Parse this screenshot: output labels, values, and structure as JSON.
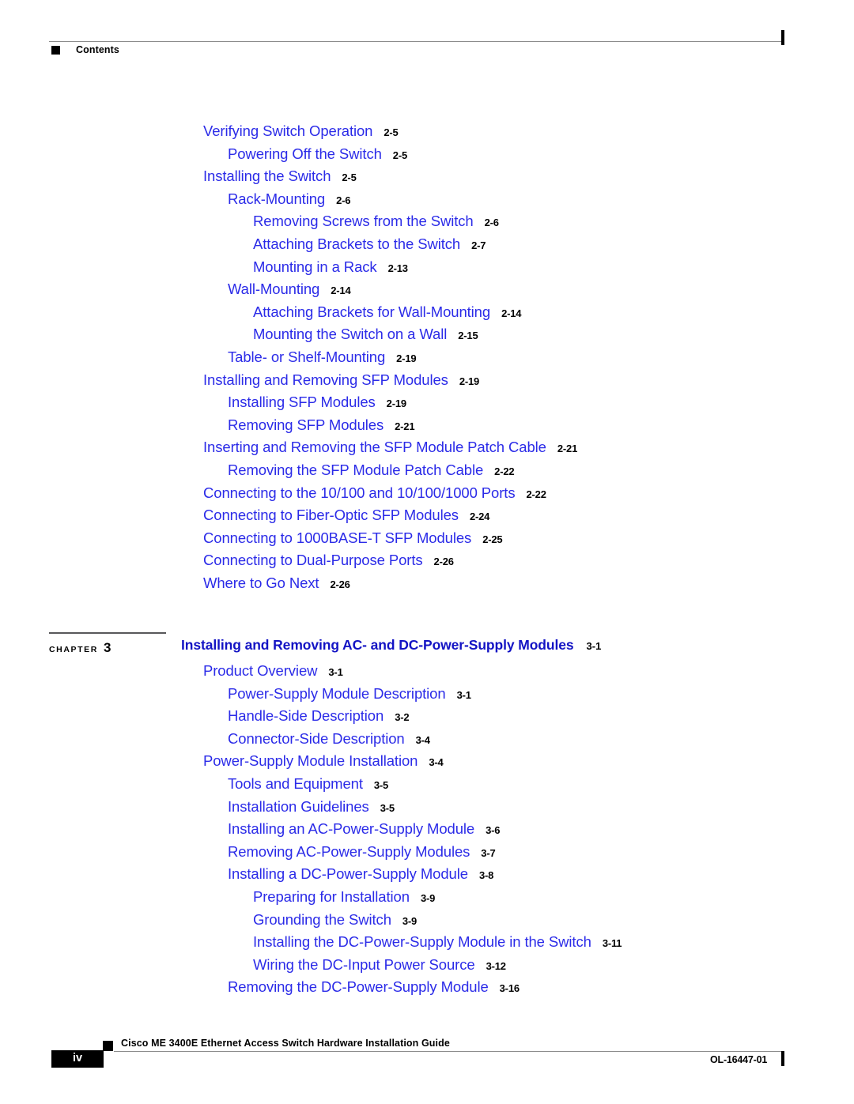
{
  "header": {
    "title": "Contents",
    "square_icon": "black-square-bullet"
  },
  "colors": {
    "entry_link": "#2b2be8",
    "chapter_title": "#1313c4",
    "page_number": "#000000",
    "rule": "#8c8c8c",
    "page_background": "#ffffff"
  },
  "toc": {
    "entries": [
      {
        "label": "Verifying Switch Operation",
        "page": "2-5",
        "level": 1
      },
      {
        "label": "Powering Off the Switch",
        "page": "2-5",
        "level": 2
      },
      {
        "label": "Installing the Switch",
        "page": "2-5",
        "level": 1
      },
      {
        "label": "Rack-Mounting",
        "page": "2-6",
        "level": 2
      },
      {
        "label": "Removing Screws from the Switch",
        "page": "2-6",
        "level": 3
      },
      {
        "label": "Attaching Brackets to the Switch",
        "page": "2-7",
        "level": 3
      },
      {
        "label": "Mounting in a Rack",
        "page": "2-13",
        "level": 3
      },
      {
        "label": "Wall-Mounting",
        "page": "2-14",
        "level": 2
      },
      {
        "label": "Attaching Brackets for Wall-Mounting",
        "page": "2-14",
        "level": 3
      },
      {
        "label": "Mounting the Switch on a Wall",
        "page": "2-15",
        "level": 3
      },
      {
        "label": "Table- or Shelf-Mounting",
        "page": "2-19",
        "level": 2
      },
      {
        "label": "Installing and Removing SFP Modules",
        "page": "2-19",
        "level": 1
      },
      {
        "label": "Installing SFP Modules",
        "page": "2-19",
        "level": 2
      },
      {
        "label": "Removing SFP Modules",
        "page": "2-21",
        "level": 2
      },
      {
        "label": "Inserting and Removing the SFP Module Patch Cable",
        "page": "2-21",
        "level": 1
      },
      {
        "label": "Removing the SFP Module Patch Cable",
        "page": "2-22",
        "level": 2
      },
      {
        "label": "Connecting to the 10/100 and 10/100/1000 Ports",
        "page": "2-22",
        "level": 1
      },
      {
        "label": "Connecting to Fiber-Optic SFP Modules",
        "page": "2-24",
        "level": 1
      },
      {
        "label": "Connecting to 1000BASE-T SFP Modules",
        "page": "2-25",
        "level": 1
      },
      {
        "label": "Connecting to Dual-Purpose Ports",
        "page": "2-26",
        "level": 1
      },
      {
        "label": "Where to Go Next",
        "page": "2-26",
        "level": 1
      }
    ],
    "entries2": [
      {
        "label": "Product Overview",
        "page": "3-1",
        "level": 1
      },
      {
        "label": "Power-Supply Module Description",
        "page": "3-1",
        "level": 2
      },
      {
        "label": "Handle-Side Description",
        "page": "3-2",
        "level": 2
      },
      {
        "label": "Connector-Side Description",
        "page": "3-4",
        "level": 2
      },
      {
        "label": "Power-Supply Module Installation",
        "page": "3-4",
        "level": 1
      },
      {
        "label": "Tools and Equipment",
        "page": "3-5",
        "level": 2
      },
      {
        "label": "Installation Guidelines",
        "page": "3-5",
        "level": 2
      },
      {
        "label": "Installing an AC-Power-Supply Module",
        "page": "3-6",
        "level": 2
      },
      {
        "label": "Removing AC-Power-Supply Modules",
        "page": "3-7",
        "level": 2
      },
      {
        "label": "Installing a DC-Power-Supply Module",
        "page": "3-8",
        "level": 2
      },
      {
        "label": "Preparing for Installation",
        "page": "3-9",
        "level": 3
      },
      {
        "label": "Grounding the Switch",
        "page": "3-9",
        "level": 3
      },
      {
        "label": "Installing the DC-Power-Supply Module in the Switch",
        "page": "3-11",
        "level": 3
      },
      {
        "label": "Wiring the DC-Input Power Source",
        "page": "3-12",
        "level": 3
      },
      {
        "label": "Removing the DC-Power-Supply Module",
        "page": "3-16",
        "level": 2
      }
    ]
  },
  "chapter": {
    "marker_word": "CHAPTER",
    "marker_number": "3",
    "title": "Installing and Removing AC- and DC-Power-Supply Modules",
    "page": "3-1"
  },
  "footer": {
    "page_number": "iv",
    "title": "Cisco ME 3400E Ethernet Access Switch Hardware Installation Guide",
    "doc_id": "OL-16447-01",
    "square_icon": "black-square-bullet"
  }
}
